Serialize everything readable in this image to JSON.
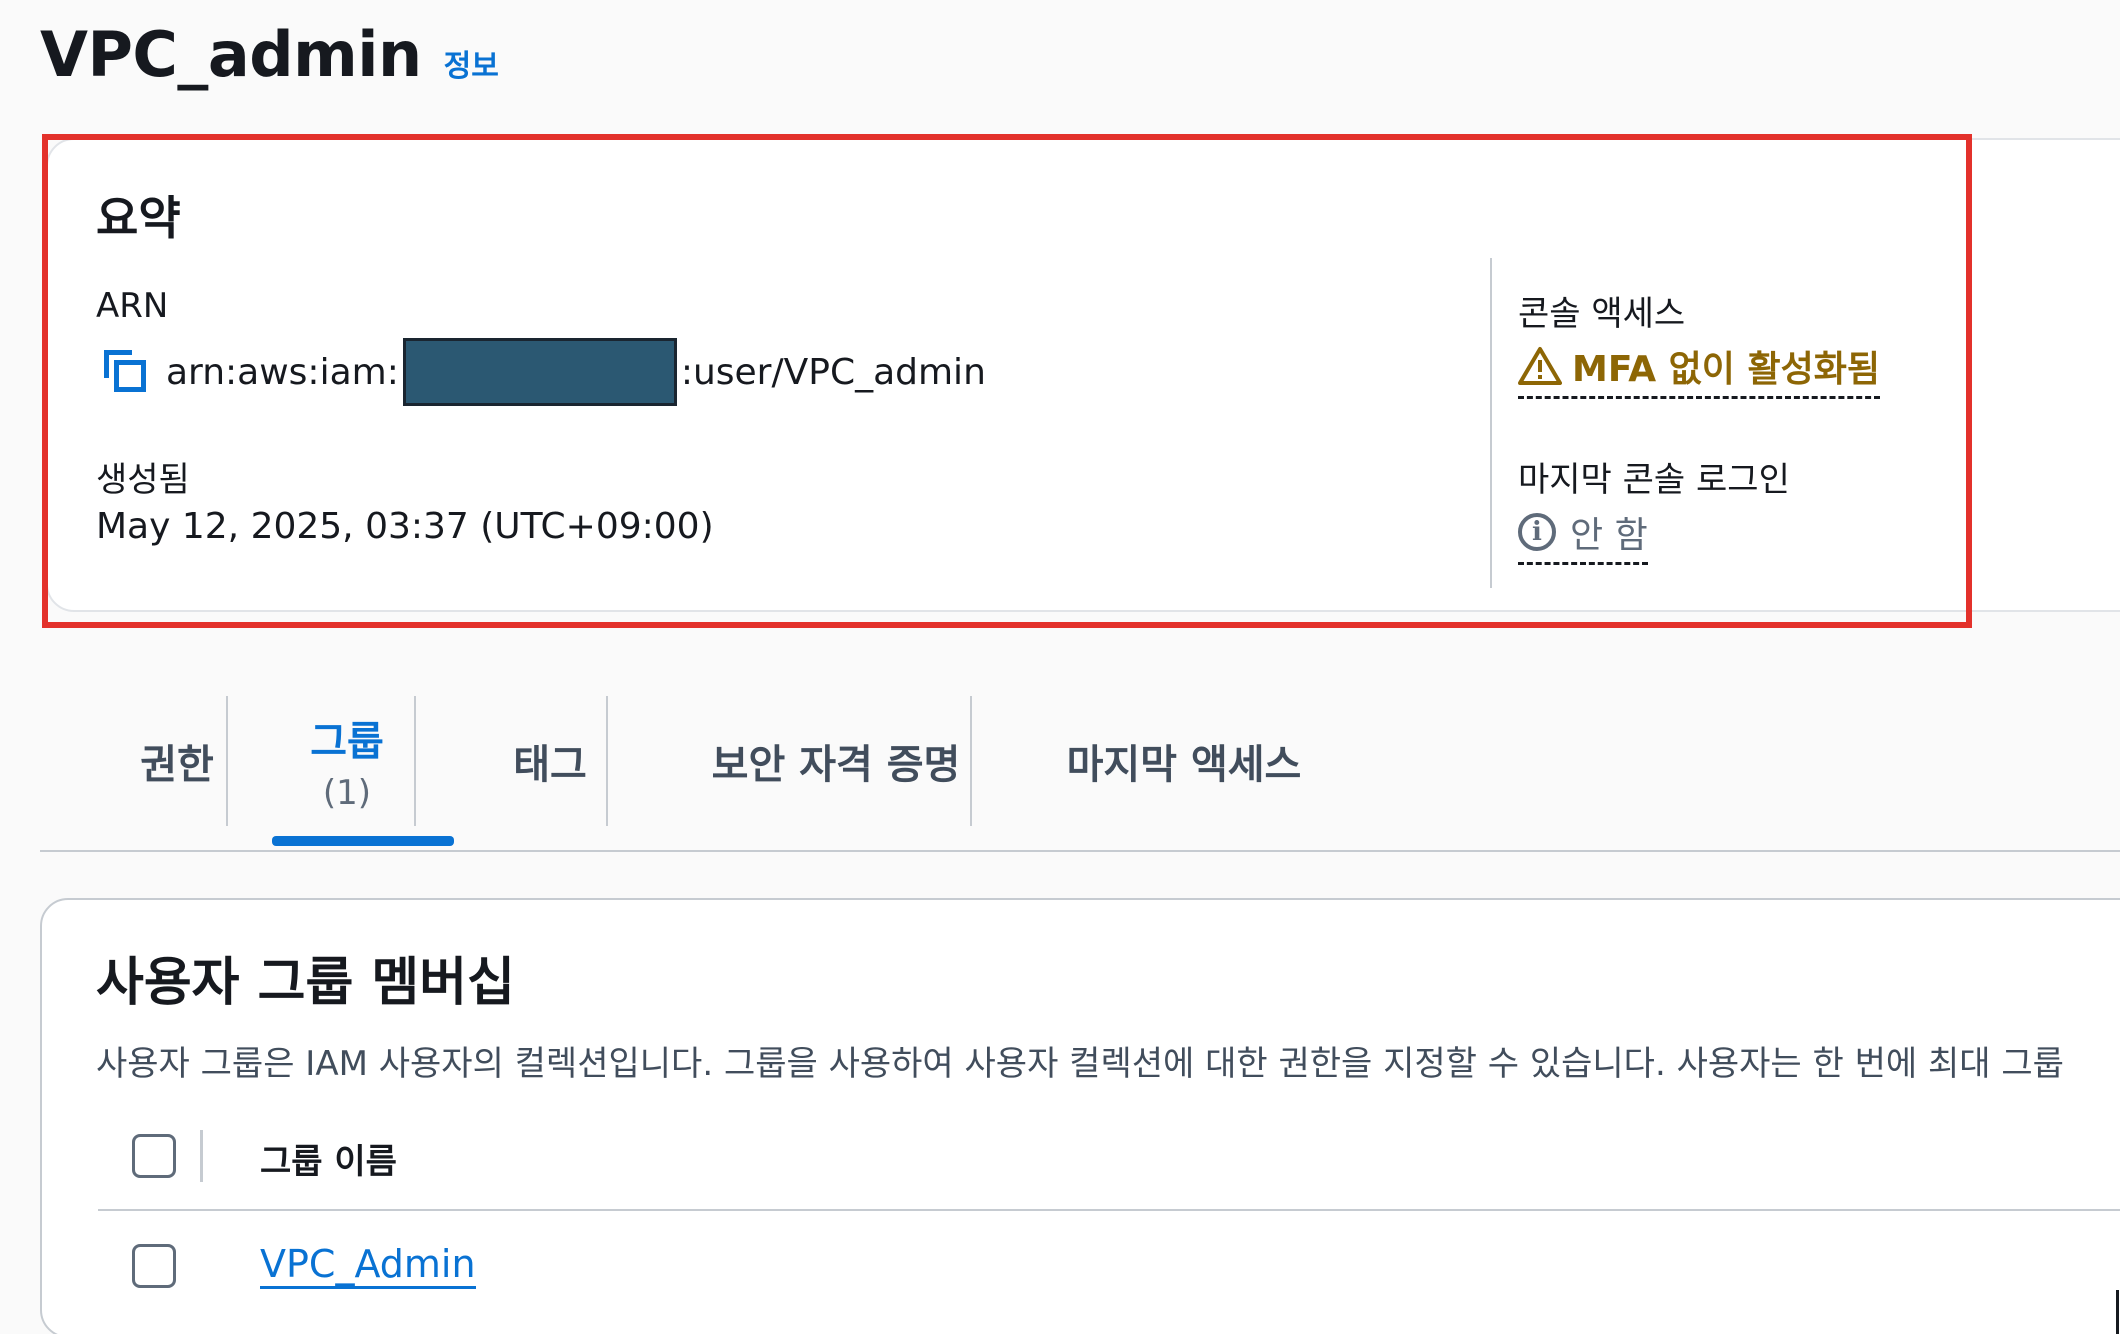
{
  "header": {
    "title": "VPC_admin",
    "info_link": "정보"
  },
  "summary": {
    "title": "요약",
    "arn_label": "ARN",
    "arn_prefix": "arn:aws:iam:",
    "arn_suffix": ":user/VPC_admin",
    "created_label": "생성됨",
    "created_value": "May 12, 2025, 03:37 (UTC+09:00)",
    "console_access_label": "콘솔 액세스",
    "console_access_value": "MFA 없이 활성화됨",
    "last_login_label": "마지막 콘솔 로그인",
    "last_login_value": "안 함",
    "colors": {
      "warning": "#8d6605",
      "highlight": "#e3312b",
      "link": "#0972d3"
    }
  },
  "tabs": [
    {
      "label": "권한",
      "count": ""
    },
    {
      "label": "그룹",
      "count": "(1)"
    },
    {
      "label": "태그",
      "count": ""
    },
    {
      "label": "보안 자격 증명",
      "count": ""
    },
    {
      "label": "마지막 액세스",
      "count": ""
    }
  ],
  "group_membership": {
    "title": "사용자 그룹 멤버십",
    "description": "사용자 그룹은 IAM 사용자의 컬렉션입니다. 그룹을 사용하여 사용자 컬렉션에 대한 권한을 지정할 수 있습니다. 사용자는 한 번에 최대 그룹",
    "column_header": "그룹 이름",
    "rows": [
      {
        "name": "VPC_Admin"
      }
    ]
  }
}
